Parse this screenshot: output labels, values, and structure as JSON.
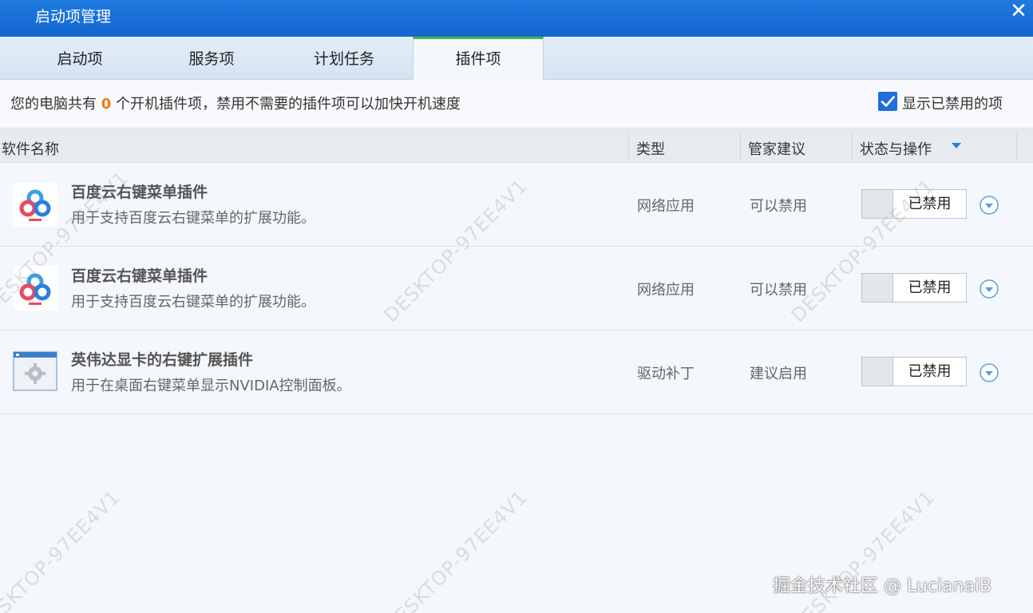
{
  "window": {
    "title": "启动项管理",
    "close_glyph": "✕"
  },
  "tabs": [
    {
      "label": "启动项"
    },
    {
      "label": "服务项"
    },
    {
      "label": "计划任务"
    },
    {
      "label": "插件项",
      "active": true
    }
  ],
  "info": {
    "prefix": "您的电脑共有 ",
    "count": "0",
    "suffix": " 个开机插件项，禁用不需要的插件项可以加快开机速度",
    "show_disabled_label": "显示已禁用的项",
    "show_disabled_checked": true
  },
  "columns": {
    "name": "软件名称",
    "type": "类型",
    "advice": "管家建议",
    "status": "状态与操作"
  },
  "rows": [
    {
      "icon": "baidu-cloud-icon",
      "name": "百度云右键菜单插件",
      "desc": "用于支持百度云右键菜单的扩展功能。",
      "type": "网络应用",
      "advice": "可以禁用",
      "status": "已禁用"
    },
    {
      "icon": "baidu-cloud-icon",
      "name": "百度云右键菜单插件",
      "desc": "用于支持百度云右键菜单的扩展功能。",
      "type": "网络应用",
      "advice": "可以禁用",
      "status": "已禁用"
    },
    {
      "icon": "settings-window-icon",
      "name": "英伟达显卡的右键扩展插件",
      "desc": "用于在桌面右键菜单显示NVIDIA控制面板。",
      "type": "驱动补丁",
      "advice": "建议启用",
      "status": "已禁用"
    }
  ],
  "watermark": "DESKTOP-97EE4V1",
  "credit": "掘金技术社区 @ LucianaiB",
  "colors": {
    "titlebar": "#1a70d8",
    "active_tab_accent": "#49b64b",
    "count": "#f07d14",
    "checkbox": "#1e6fd9",
    "dropdown": "#5aa0e0"
  }
}
